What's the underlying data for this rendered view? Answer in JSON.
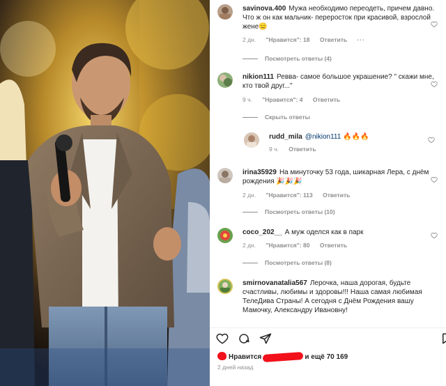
{
  "comments": [
    {
      "username": "savinova.400",
      "text": "Мужа необходимо переодеть, причем давно. Что ж он как мальчик- переросток при красивой, взрослой жене",
      "emoji": "😑",
      "time": "2 дн.",
      "likes": "\"Нравится\": 18",
      "reply": "Ответить",
      "more": "···",
      "replies_toggle": "Посмотреть ответы (4)"
    },
    {
      "username": "nikion111",
      "text": "Ревва- самое большое украшение? \" скажи мне, кто твой друг...\"",
      "time": "9 ч.",
      "likes": "\"Нравится\": 4",
      "reply": "Ответить",
      "replies_toggle": "Скрыть ответы",
      "nested": {
        "username": "rudd_mila",
        "mention": "@nikion111",
        "emoji": "🔥🔥🔥",
        "time": "9 ч.",
        "reply": "Ответить"
      }
    },
    {
      "username": "irina35929",
      "text": "На минуточку 53 года, шикарная Лера, с днём рождения",
      "emoji": "🎉🎉🎉",
      "time": "2 дн.",
      "likes": "\"Нравится\": 113",
      "reply": "Ответить",
      "replies_toggle": "Посмотреть ответы (10)"
    },
    {
      "username": "coco_202__",
      "text": "А муж оделся как в парк",
      "time": "2 дн.",
      "likes": "\"Нравится\": 80",
      "reply": "Ответить",
      "replies_toggle": "Посмотреть ответы (8)"
    },
    {
      "username": "smirnovanatalia567",
      "text": "Лерочка, наша дорогая, будьте счастливы, любимы и здоровы!!! Наша самая любимая ТелеДива Страны! А сегодня с Днём Рождения вашу Мамочку, Александру Ивановну!"
    }
  ],
  "post_actions": {
    "likes_prefix": "Нравится",
    "likes_suffix": "и ещё 70 169",
    "date": "2 дней назад"
  },
  "icons": [
    "heart-icon",
    "comment-icon",
    "share-icon",
    "bookmark-icon"
  ],
  "colors": {
    "text": "#262626",
    "muted": "#8e8e8e",
    "link": "#00376b",
    "redaction": "#f2101b"
  }
}
